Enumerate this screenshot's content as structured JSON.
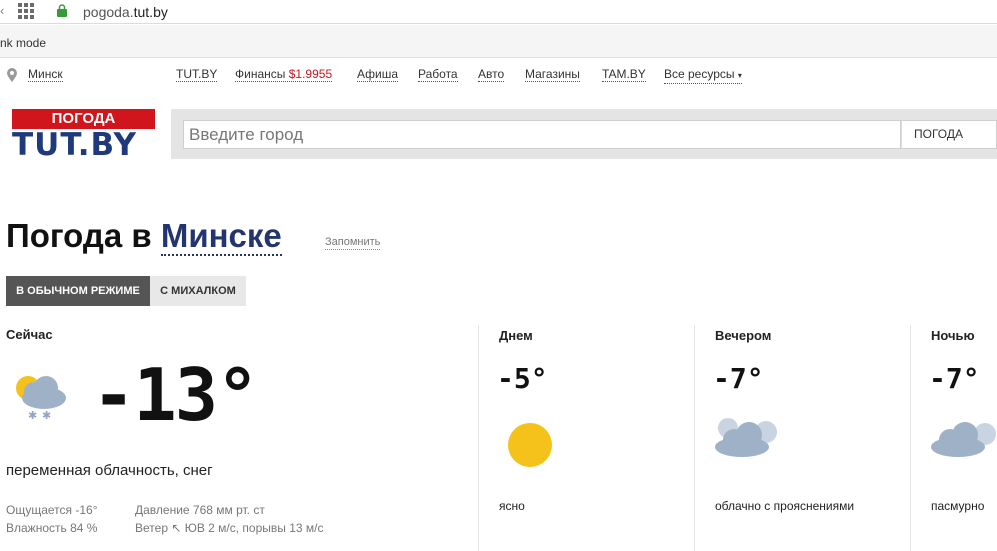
{
  "browser": {
    "url_prefix": "pogoda.",
    "url_domain": "tut.by",
    "bookmark_text": "nk mode"
  },
  "topnav": {
    "city": "Минск",
    "items": [
      "TUT.BY",
      "Финансы",
      "Афиша",
      "Работа",
      "Авто",
      "Магазины",
      "TAM.BY",
      "Все ресурсы"
    ],
    "finance_value": "$1.9955",
    "caret": "▾"
  },
  "logo": {
    "top": "ПОГОДА",
    "bottom": "TUT.BY"
  },
  "search": {
    "placeholder": "Введите город",
    "select_value": "ПОГОДА"
  },
  "heading": {
    "prefix": "Погода в ",
    "city": "Минске",
    "remember": "Запомнить"
  },
  "modes": [
    "В ОБЫЧНОМ РЕЖИМЕ",
    "С МИХАЛКОМ"
  ],
  "now": {
    "label": "Сейчас",
    "temp": "-13°",
    "description": "переменная облачность, снег",
    "feels": "Ощущается -16°",
    "humidity": "Влажность 84 %",
    "pressure": "Давление 768 мм рт. ст",
    "wind": "Ветер ↖ ЮВ 2 м/с, порывы 13 м/с",
    "icon": "cloud-sun-snow-icon"
  },
  "periods": [
    {
      "label": "Днем",
      "temp": "-5°",
      "desc": "ясно",
      "icon": "sun-icon"
    },
    {
      "label": "Вечером",
      "temp": "-7°",
      "desc": "облачно с прояснениями",
      "icon": "cloud-moon-icon"
    },
    {
      "label": "Ночью",
      "temp": "-7°",
      "desc": "пасмурно",
      "icon": "clouds-icon"
    }
  ],
  "colors": {
    "logo_red": "#d0151d",
    "logo_blue": "#1f3a7a",
    "city_blue": "#23356f",
    "sun_yellow": "#f4c21a",
    "cloud_gray": "#9fb1c6"
  }
}
